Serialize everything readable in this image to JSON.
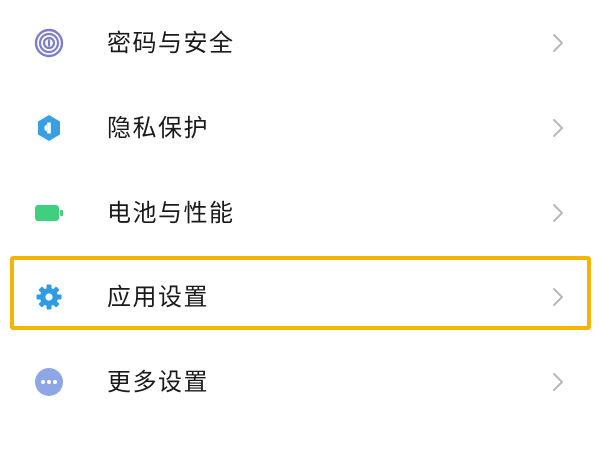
{
  "settings": {
    "items": [
      {
        "label": "密码与安全",
        "icon": "fingerprint-icon",
        "icon_color": "#7d7fc6"
      },
      {
        "label": "隐私保护",
        "icon": "privacy-shield-icon",
        "icon_color": "#3a9fe0"
      },
      {
        "label": "电池与性能",
        "icon": "battery-icon",
        "icon_color": "#3fcf7f"
      },
      {
        "label": "应用设置",
        "icon": "gear-icon",
        "icon_color": "#2f9be3",
        "highlighted": true
      },
      {
        "label": "更多设置",
        "icon": "more-dots-icon",
        "icon_color": "#8fa6e6"
      }
    ]
  },
  "colors": {
    "highlight_border": "#f5b400",
    "chevron": "#b8b8b8",
    "text": "#1a1a1a",
    "background": "#ffffff"
  }
}
